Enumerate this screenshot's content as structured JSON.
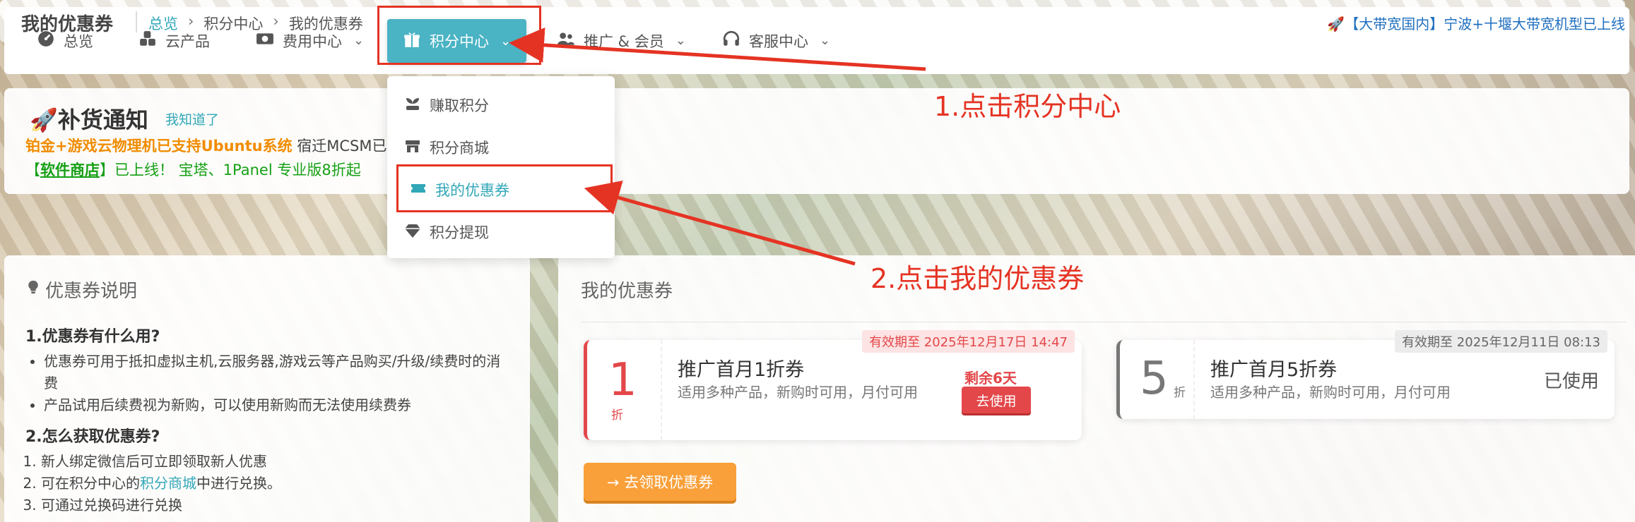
{
  "nav": {
    "items": [
      {
        "label": "总览",
        "icon": "dashboard-icon"
      },
      {
        "label": "云产品",
        "icon": "cubes-icon"
      },
      {
        "label": "费用中心",
        "icon": "money-icon"
      },
      {
        "label": "积分中心",
        "icon": "gift-icon"
      },
      {
        "label": "推广 & 会员",
        "icon": "users-icon"
      },
      {
        "label": "客服中心",
        "icon": "headset-icon"
      }
    ]
  },
  "dropdown": {
    "items": [
      {
        "label": "赚取积分",
        "icon": "seedling-icon"
      },
      {
        "label": "积分商城",
        "icon": "store-icon"
      },
      {
        "label": "我的优惠券",
        "icon": "ticket-icon"
      },
      {
        "label": "积分提现",
        "icon": "diamond-icon"
      }
    ]
  },
  "notice": {
    "title": "🚀补货通知",
    "dismiss": "我知道了",
    "line1_highlight": "铂金+游戏云物理机已支持Ubuntu系统",
    "line1_rest": " 宿迁MCSM已",
    "line2_prefix": "【",
    "line2_link": "软件商店",
    "line2_suffix": "】已上线！ 宝塔、1Panel 专业版8折起"
  },
  "breadcrumb": {
    "title": "我的优惠券",
    "items": [
      "总览",
      "积分中心",
      "我的优惠券"
    ],
    "ticker": "🚀【大带宽国内】宁波+十堰大带宽机型已上线"
  },
  "help": {
    "heading": "优惠券说明",
    "q1": "1.优惠券有什么用?",
    "q1_points": [
      "优惠券可用于抵扣虚拟主机,云服务器,游戏云等产品购买/升级/续费时的消费",
      "产品试用后续费视为新购，可以使用新购而无法使用续费券"
    ],
    "q2": "2.怎么获取优惠券?",
    "q2_steps": {
      "s1": "新人绑定微信后可立即领取新人优惠",
      "s2_pre": "可在积分中心的",
      "s2_link": "积分商城",
      "s2_post": "中进行兑换。",
      "s3": "可通过兑换码进行兑换"
    }
  },
  "coupons": {
    "heading": "我的优惠券",
    "list": [
      {
        "discount": "1",
        "unit": "折",
        "name": "推广首月1折券",
        "desc": "适用多种产品，新购时可用，月付可用",
        "expire": "有效期至 2025年12月17日 14:47",
        "remain": "剩余6天",
        "action": "去使用"
      },
      {
        "discount": "5",
        "unit": "折",
        "name": "推广首月5折券",
        "desc": "适用多种产品，新购时可用，月付可用",
        "expire": "有效期至 2025年12月11日 08:13",
        "status": "已使用"
      }
    ],
    "get_button": "→ 去领取优惠券"
  },
  "annotations": {
    "step1": "1.点击积分中心",
    "step2": "2.点击我的优惠券"
  },
  "colors": {
    "accent": "#4ab3c4",
    "annotation_red": "#e53323",
    "coupon_red": "#e3474a",
    "orange": "#f9a03a"
  }
}
